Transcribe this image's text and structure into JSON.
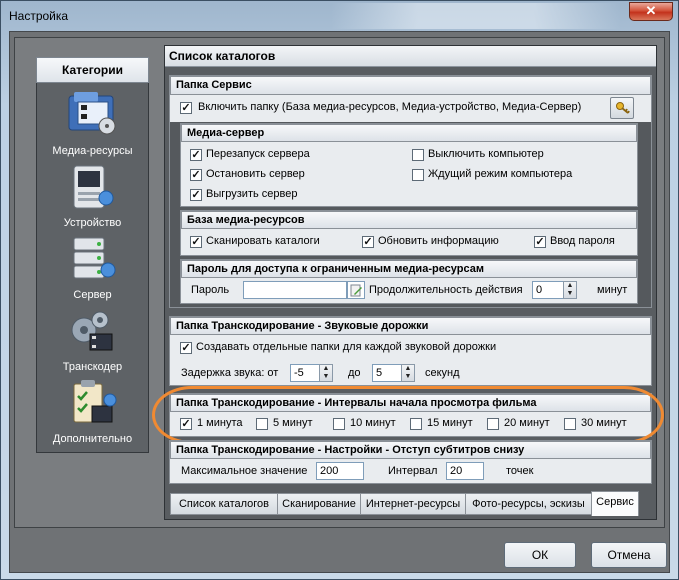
{
  "window": {
    "title": "Настройка",
    "close_glyph": "✕"
  },
  "categories": {
    "header": "Категории",
    "items": [
      {
        "label": "Медиа-ресурсы",
        "icon": "media-resources-icon"
      },
      {
        "label": "Устройство",
        "icon": "device-icon"
      },
      {
        "label": "Сервер",
        "icon": "server-icon"
      },
      {
        "label": "Транскодер",
        "icon": "transcoder-icon"
      },
      {
        "label": "Дополнительно",
        "icon": "additional-icon"
      }
    ]
  },
  "main": {
    "header": "Список каталогов",
    "service_folder": {
      "title": "Папка Сервис",
      "enable_label": "Включить папку (База медиа-ресурсов, Медиа-устройство, Медиа-Сервер)",
      "enable_checked": true
    },
    "media_server": {
      "title": "Медиа-сервер",
      "options": [
        {
          "label": "Перезапуск сервера",
          "checked": true
        },
        {
          "label": "Выключить компьютер",
          "checked": false
        },
        {
          "label": "Остановить сервер",
          "checked": true
        },
        {
          "label": "Ждущий режим компьютера",
          "checked": false
        },
        {
          "label": "Выгрузить сервер",
          "checked": true
        }
      ]
    },
    "media_db": {
      "title": "База медиа-ресурсов",
      "options": [
        {
          "label": "Сканировать каталоги",
          "checked": true
        },
        {
          "label": "Обновить информацию",
          "checked": true
        },
        {
          "label": "Ввод пароля",
          "checked": true
        }
      ]
    },
    "password": {
      "title": "Пароль для доступа к ограниченным медиа-ресурсам",
      "password_label": "Пароль",
      "password_value": "",
      "duration_label": "Продолжительность действия",
      "duration_value": "0",
      "duration_unit": "минут"
    },
    "audio_tracks": {
      "title": "Папка Транскодирование - Звуковые дорожки",
      "separate_label": "Создавать отдельные папки для каждой звуковой дорожки",
      "separate_checked": true,
      "delay_label": "Задержка звука: от",
      "delay_from": "-5",
      "to_label": "до",
      "delay_to": "5",
      "unit": "секунд"
    },
    "intervals": {
      "title": "Папка Транскодирование - Интервалы начала просмотра фильма",
      "options": [
        {
          "label": "1 минута",
          "checked": true
        },
        {
          "label": "5 минут",
          "checked": false
        },
        {
          "label": "10 минут",
          "checked": false
        },
        {
          "label": "15 минут",
          "checked": false
        },
        {
          "label": "20 минут",
          "checked": false
        },
        {
          "label": "30 минут",
          "checked": false
        }
      ]
    },
    "subtitles": {
      "title": "Папка Транскодирование - Настройки - Отступ субтитров снизу",
      "max_label": "Максимальное значение",
      "max_value": "200",
      "interval_label": "Интервал",
      "interval_value": "20",
      "unit": "точек"
    }
  },
  "tabs": [
    {
      "label": "Список каталогов",
      "active": false
    },
    {
      "label": "Сканирование",
      "active": false
    },
    {
      "label": "Интернет-ресурсы",
      "active": false
    },
    {
      "label": "Фото-ресурсы, эскизы",
      "active": false
    },
    {
      "label": "Сервис",
      "active": true
    }
  ],
  "buttons": {
    "ok": "ОК",
    "cancel": "Отмена"
  },
  "colors": {
    "highlight": "#f08a32",
    "panel_dark": "#55595d",
    "header_light": "#eef1f4"
  },
  "check_glyph": "✓"
}
